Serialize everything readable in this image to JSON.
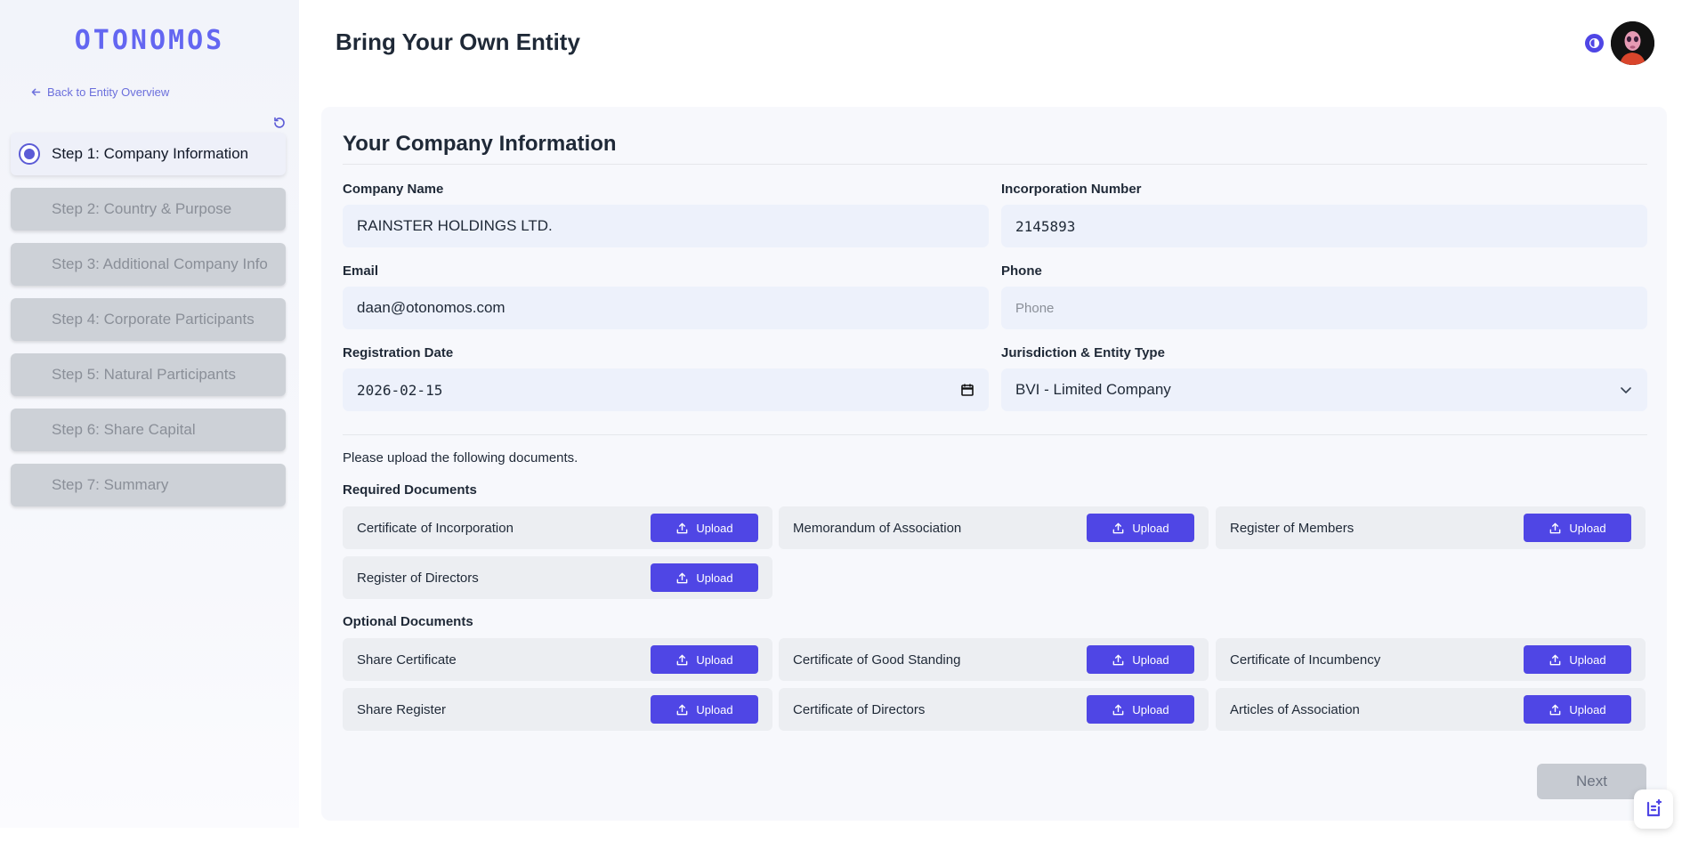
{
  "brand": {
    "logo": "OTONOMOS",
    "accent": "#4f46e5"
  },
  "sidebar": {
    "back_label": "Back to Entity Overview",
    "steps": [
      {
        "label": "Step 1: Company Information",
        "active": true
      },
      {
        "label": "Step 2: Country & Purpose",
        "active": false
      },
      {
        "label": "Step 3: Additional Company Info",
        "active": false
      },
      {
        "label": "Step 4: Corporate Participants",
        "active": false
      },
      {
        "label": "Step 5: Natural Participants",
        "active": false
      },
      {
        "label": "Step 6: Share Capital",
        "active": false
      },
      {
        "label": "Step 7: Summary",
        "active": false
      }
    ]
  },
  "header": {
    "title": "Bring Your Own Entity"
  },
  "form": {
    "title": "Your Company Information",
    "company_name": {
      "label": "Company Name",
      "value": "RAINSTER HOLDINGS LTD."
    },
    "incorporation_number": {
      "label": "Incorporation Number",
      "value": "2145893"
    },
    "email": {
      "label": "Email",
      "value": "daan@otonomos.com"
    },
    "phone": {
      "label": "Phone",
      "value": "",
      "placeholder": "Phone"
    },
    "registration_date": {
      "label": "Registration Date",
      "value": "2026-02-15"
    },
    "jurisdiction": {
      "label": "Jurisdiction & Entity Type",
      "value": "BVI - Limited Company"
    }
  },
  "documents": {
    "intro": "Please upload the following documents.",
    "upload_label": "Upload",
    "required_label": "Required Documents",
    "required": [
      "Certificate of Incorporation",
      "Memorandum of Association",
      "Register of Members",
      "Register of Directors"
    ],
    "optional_label": "Optional Documents",
    "optional": [
      "Share Certificate",
      "Certificate of Good Standing",
      "Certificate of Incumbency",
      "Share Register",
      "Certificate of Directors",
      "Articles of Association"
    ]
  },
  "footer": {
    "next_label": "Next"
  }
}
